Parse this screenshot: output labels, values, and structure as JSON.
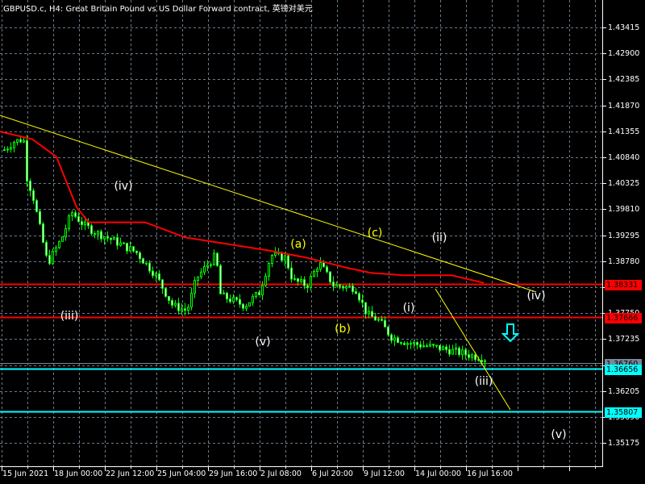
{
  "header": {
    "title": "GBPUSD.c, H4:  Great Britain Pound vs US Dollar Forward contract, 英镑对美元"
  },
  "colors": {
    "background": "#000000",
    "grid": "#6b7b8c",
    "bull_body": "#000000",
    "bear_body": "#ffffff",
    "wick": "#00ff00",
    "ma": "#ff0000",
    "trendline": "#ffff00",
    "red_level": "#ff0000",
    "cyan_level": "#00ffff",
    "gray_level": "#778899",
    "wave_white": "#ffffff",
    "wave_yellow": "#ffff00"
  },
  "chart_data": {
    "type": "candlestick",
    "symbol": "GBPUSD.c",
    "timeframe": "H4",
    "y_ticks": [
      "1.43415",
      "1.42900",
      "1.42385",
      "1.41870",
      "1.41355",
      "1.40840",
      "1.40325",
      "1.39810",
      "1.39295",
      "1.38780",
      "1.38265",
      "1.37750",
      "1.37235",
      "1.36720",
      "1.36205",
      "1.35690",
      "1.35175"
    ],
    "ylim": [
      1.3475,
      1.4395
    ],
    "x_ticks": [
      "15 Jun 2021",
      "18 Jun 00:00",
      "22 Jun 12:00",
      "25 Jun 04:00",
      "29 Jun 16:00",
      "2 Jul 08:00",
      "6 Jul 20:00",
      "9 Jul 12:00",
      "14 Jul 00:00",
      "16 Jul 16:00"
    ],
    "bar_count": 150,
    "price_path": [
      [
        0,
        1.4099
      ],
      [
        8,
        1.4115
      ],
      [
        16,
        1.412
      ],
      [
        18,
        1.405
      ],
      [
        24,
        1.4005
      ],
      [
        36,
        1.3873
      ],
      [
        48,
        1.3925
      ],
      [
        56,
        1.3975
      ],
      [
        66,
        1.395
      ],
      [
        76,
        1.3935
      ],
      [
        90,
        1.392
      ],
      [
        110,
        1.3895
      ],
      [
        126,
        1.385
      ],
      [
        140,
        1.379
      ],
      [
        152,
        1.378
      ],
      [
        160,
        1.3845
      ],
      [
        176,
        1.389
      ],
      [
        180,
        1.381
      ],
      [
        200,
        1.379
      ],
      [
        212,
        1.3815
      ],
      [
        222,
        1.389
      ],
      [
        234,
        1.3885
      ],
      [
        240,
        1.384
      ],
      [
        252,
        1.383
      ],
      [
        262,
        1.3875
      ],
      [
        274,
        1.383
      ],
      [
        292,
        1.3825
      ],
      [
        302,
        1.3772
      ],
      [
        312,
        1.376
      ],
      [
        322,
        1.3728
      ],
      [
        336,
        1.3716
      ],
      [
        364,
        1.3705
      ],
      [
        400,
        1.3685
      ]
    ],
    "ma_path": [
      [
        0,
        1.4135
      ],
      [
        40,
        1.412
      ],
      [
        70,
        1.4085
      ],
      [
        95,
        1.3985
      ],
      [
        110,
        1.3955
      ],
      [
        180,
        1.3955
      ],
      [
        230,
        1.3925
      ],
      [
        270,
        1.3915
      ],
      [
        330,
        1.39
      ],
      [
        380,
        1.3885
      ],
      [
        430,
        1.3865
      ],
      [
        460,
        1.3855
      ],
      [
        500,
        1.385
      ],
      [
        560,
        1.385
      ],
      [
        600,
        1.3835
      ]
    ],
    "levels": [
      {
        "price": "1.38331",
        "color": "red"
      },
      {
        "price": "1.37666",
        "color": "red"
      },
      {
        "price": "1.36760",
        "color": "gray"
      },
      {
        "price": "1.36656",
        "color": "cyan"
      },
      {
        "price": "1.35807",
        "color": "cyan"
      }
    ],
    "wave_labels": [
      {
        "text": "(iii)",
        "color": "white"
      },
      {
        "text": "(iv)",
        "color": "white"
      },
      {
        "text": "(v)",
        "color": "white"
      },
      {
        "text": "(a)",
        "color": "yellow"
      },
      {
        "text": "(b)",
        "color": "yellow"
      },
      {
        "text": "(c)",
        "color": "yellow"
      },
      {
        "text": "(i)",
        "color": "white"
      },
      {
        "text": "(ii)",
        "color": "white"
      },
      {
        "text": "(iii)",
        "color": "white"
      },
      {
        "text": "(iv)",
        "color": "white"
      },
      {
        "text": "(v)",
        "color": "white"
      }
    ],
    "signal_arrow": "down-arrow"
  }
}
